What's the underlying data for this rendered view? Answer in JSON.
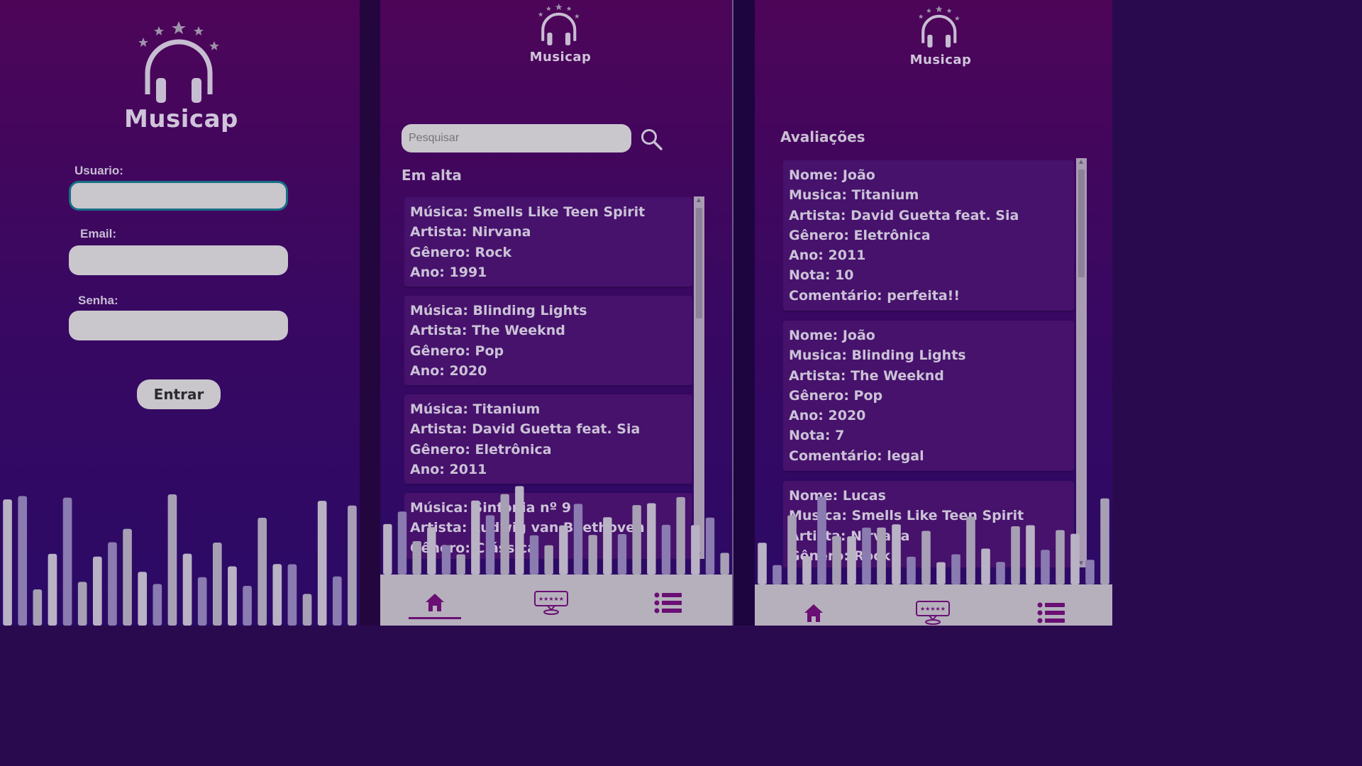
{
  "colors": {
    "purple_top": "#4d0558",
    "purple_bottom": "#2a0a66",
    "input_bg": "#c9c6cc",
    "text_light": "#cbc2d6",
    "card_bg": "#46126c",
    "icon_purple": "#6a0f73",
    "navbar_bg": "#b6b0bd"
  },
  "login": {
    "app_name": "Musicap",
    "usuario_label": "Usuario:",
    "email_label": "Email:",
    "senha_label": "Senha:",
    "usuario_value": "",
    "email_value": "",
    "senha_value": "",
    "submit_label": "Entrar"
  },
  "home": {
    "app_name": "Musicap",
    "search_placeholder": "Pesquisar",
    "section_title": "Em alta",
    "songs": [
      {
        "musica": "Música: Smells Like Teen Spirit",
        "artista": "Artista: Nirvana",
        "genero": "Gênero: Rock",
        "ano": "Ano: 1991"
      },
      {
        "musica": "Música: Blinding Lights",
        "artista": "Artista: The Weeknd",
        "genero": "Gênero: Pop",
        "ano": "Ano: 2020"
      },
      {
        "musica": "Música: Titanium",
        "artista": "Artista: David Guetta feat. Sia",
        "genero": "Gênero: Eletrônica",
        "ano": "Ano: 2011"
      },
      {
        "musica": "Música: Sinfonia nº 9",
        "artista": "Artista: Ludwig van Beethoven",
        "genero": "Gênero: Clássica",
        "ano": ""
      }
    ]
  },
  "reviews": {
    "app_name": "Musicap",
    "section_title": "Avaliações",
    "items": [
      {
        "nome": "Nome: João",
        "musica": "Musica: Titanium",
        "artista": "Artista: David Guetta feat. Sia",
        "genero": "Gênero: Eletrônica",
        "ano": "Ano: 2011",
        "nota": "Nota: 10",
        "comentario": "Comentário: perfeita!!"
      },
      {
        "nome": "Nome: João",
        "musica": "Musica: Blinding Lights",
        "artista": "Artista: The Weeknd",
        "genero": "Gênero: Pop",
        "ano": "Ano: 2020",
        "nota": "Nota: 7",
        "comentario": "Comentário: legal"
      },
      {
        "nome": "Nome: Lucas",
        "musica": "Musica: Smells Like Teen Spirit",
        "artista": "Artista: Nirvana",
        "genero": "Gênero: Rock",
        "ano": "",
        "nota": "",
        "comentario": ""
      }
    ]
  },
  "nav": {
    "items": [
      {
        "icon": "home-icon"
      },
      {
        "icon": "rating-icon"
      },
      {
        "icon": "list-icon"
      }
    ]
  }
}
